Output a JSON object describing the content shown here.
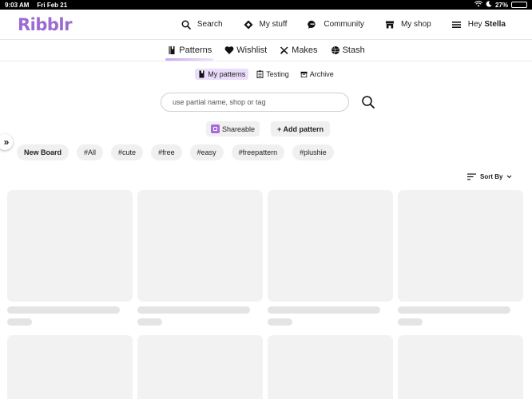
{
  "status_bar": {
    "time": "9:03 AM",
    "date": "Fri Feb 21",
    "battery_pct": "27%",
    "battery_level": 0.27
  },
  "app": {
    "logo": "Ribblr",
    "brand_color": "#9a6bd3"
  },
  "topnav": [
    {
      "label": "Search",
      "icon": "search-icon"
    },
    {
      "label": "My stuff",
      "icon": "diamond-icon"
    },
    {
      "label": "Community",
      "icon": "chat-bubble-icon"
    },
    {
      "label": "My shop",
      "icon": "shop-icon"
    }
  ],
  "user_menu": {
    "greeting": "Hey",
    "name": "Stella",
    "icon": "hamburger-icon"
  },
  "tabs": [
    {
      "label": "Patterns",
      "icon": "pattern-book-icon",
      "active": true
    },
    {
      "label": "Wishlist",
      "icon": "heart-icon",
      "active": false
    },
    {
      "label": "Makes",
      "icon": "needles-icon",
      "active": false
    },
    {
      "label": "Stash",
      "icon": "yarn-ball-icon",
      "active": false
    }
  ],
  "subtabs": [
    {
      "label": "My patterns",
      "icon": "pattern-book-icon",
      "active": true
    },
    {
      "label": "Testing",
      "icon": "clipboard-icon",
      "active": false
    },
    {
      "label": "Archive",
      "icon": "archive-box-icon",
      "active": false
    }
  ],
  "search": {
    "placeholder": "use partial name, shop or tag"
  },
  "actions": {
    "shareable": "Shareable",
    "add_pattern": "+ Add pattern"
  },
  "tags": [
    "New Board",
    "#All",
    "#cute",
    "#free",
    "#easy",
    "#freepattern",
    "#plushie"
  ],
  "sort": {
    "label": "Sort By"
  }
}
